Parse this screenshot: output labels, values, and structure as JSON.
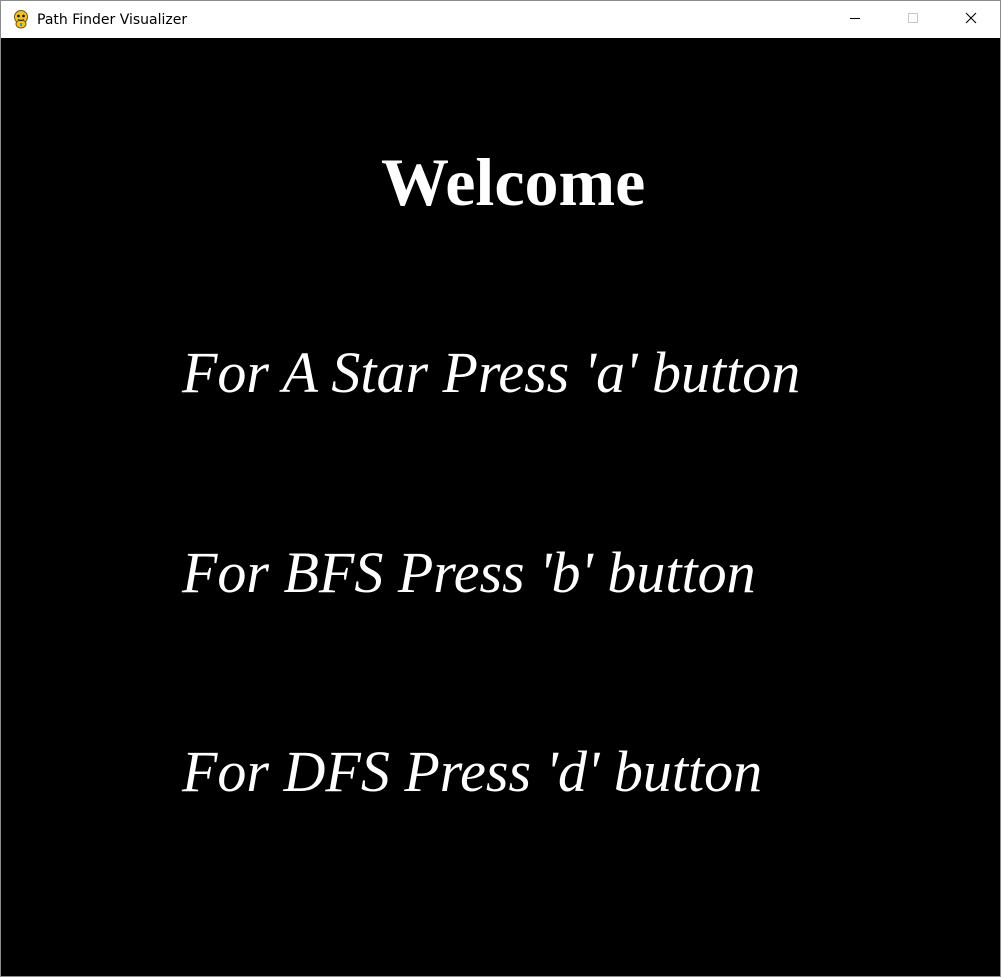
{
  "window": {
    "title": "Path Finder Visualizer",
    "app_icon": "pygame-snake-icon",
    "controls": [
      "minimize-icon",
      "maximize-icon",
      "close-icon"
    ]
  },
  "screen": {
    "background_color": "#000000",
    "text_color": "#ffffff",
    "heading": "Welcome",
    "instructions": [
      "For A Star Press 'a' button",
      "For BFS Press 'b' button",
      "For DFS Press 'd' button"
    ]
  }
}
